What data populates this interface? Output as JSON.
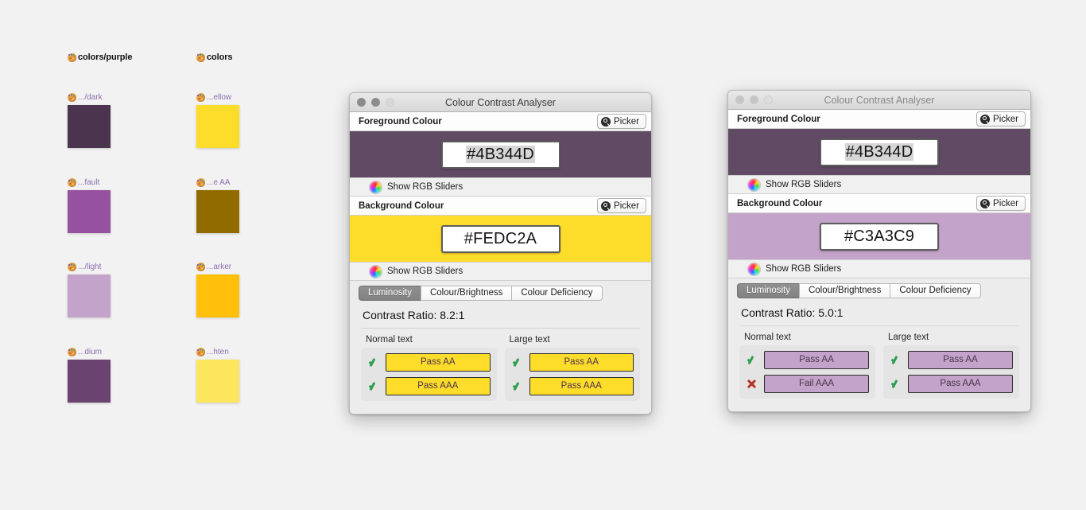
{
  "canvas": {
    "background": "#f2f2f2"
  },
  "palette_panel": {
    "groups": [
      {
        "title": "colors/purple",
        "icon": "palette-icon"
      },
      {
        "title": "colors",
        "icon": "palette-icon"
      }
    ],
    "swatches": [
      {
        "label": ".../dark",
        "color": "#4B344D",
        "icon": "palette-icon",
        "col": 0,
        "row": 0
      },
      {
        "label": "...fault",
        "color": "#96519F",
        "icon": "palette-icon",
        "col": 0,
        "row": 1
      },
      {
        "label": ".../light",
        "color": "#C3A3C9",
        "icon": "palette-icon",
        "col": 0,
        "row": 2
      },
      {
        "label": "...dium",
        "color": "#6B4370",
        "icon": "palette-icon",
        "col": 0,
        "row": 3
      },
      {
        "label": "...ellow",
        "color": "#FEDC2A",
        "icon": "palette-icon",
        "col": 1,
        "row": 0
      },
      {
        "label": "...e AA",
        "color": "#8F6B00",
        "icon": "palette-icon",
        "col": 1,
        "row": 1
      },
      {
        "label": "...arker",
        "color": "#FFBF0A",
        "icon": "palette-icon",
        "col": 1,
        "row": 2
      },
      {
        "label": "...hten",
        "color": "#FCE65E",
        "icon": "palette-icon",
        "col": 1,
        "row": 3
      }
    ]
  },
  "window_1": {
    "title": "Colour Contrast Analyser",
    "active": true,
    "traffic_lights": [
      "close",
      "minimize",
      "zoom"
    ],
    "foreground": {
      "label": "Foreground Colour",
      "picker_label": "Picker",
      "picker_icon": "eyedropper-picker-icon",
      "hex": "#4B344D",
      "selected": true,
      "swatch_color": "#614A64",
      "rgb_toggle_label": "Show RGB Sliders",
      "rgb_toggle_icon": "colour-wheel-icon"
    },
    "background": {
      "label": "Background Colour",
      "picker_label": "Picker",
      "picker_icon": "eyedropper-picker-icon",
      "hex": "#FEDC2A",
      "selected": false,
      "swatch_color": "#FEDC2A",
      "rgb_toggle_label": "Show RGB Sliders",
      "rgb_toggle_icon": "colour-wheel-icon"
    },
    "tabs": [
      {
        "label": "Luminosity",
        "active": true
      },
      {
        "label": "Colour/Brightness",
        "active": false
      },
      {
        "label": "Colour Deficiency",
        "active": false
      }
    ],
    "contrast_ratio": "Contrast Ratio: 8.2:1",
    "results": {
      "normal": {
        "caption": "Normal text",
        "rows": [
          {
            "mark": "pass",
            "text": "Pass AA",
            "bg": "#FEDC2A",
            "fg": "#4B344D"
          },
          {
            "mark": "pass",
            "text": "Pass AAA",
            "bg": "#FEDC2A",
            "fg": "#4B344D"
          }
        ]
      },
      "large": {
        "caption": "Large text",
        "rows": [
          {
            "mark": "pass",
            "text": "Pass AA",
            "bg": "#FEDC2A",
            "fg": "#4B344D"
          },
          {
            "mark": "pass",
            "text": "Pass AAA",
            "bg": "#FEDC2A",
            "fg": "#4B344D"
          }
        ]
      }
    }
  },
  "window_2": {
    "title": "Colour Contrast Analyser",
    "active": false,
    "traffic_lights": [
      "close",
      "minimize",
      "zoom"
    ],
    "foreground": {
      "label": "Foreground Colour",
      "picker_label": "Picker",
      "picker_icon": "eyedropper-picker-icon",
      "hex": "#4B344D",
      "selected": true,
      "swatch_color": "#614A64",
      "rgb_toggle_label": "Show RGB Sliders",
      "rgb_toggle_icon": "colour-wheel-icon"
    },
    "background": {
      "label": "Background Colour",
      "picker_label": "Picker",
      "picker_icon": "eyedropper-picker-icon",
      "hex": "#C3A3C9",
      "selected": false,
      "swatch_color": "#C3A3C9",
      "rgb_toggle_label": "Show RGB Sliders",
      "rgb_toggle_icon": "colour-wheel-icon"
    },
    "tabs": [
      {
        "label": "Luminosity",
        "active": true
      },
      {
        "label": "Colour/Brightness",
        "active": false
      },
      {
        "label": "Colour Deficiency",
        "active": false
      }
    ],
    "contrast_ratio": "Contrast Ratio: 5.0:1",
    "results": {
      "normal": {
        "caption": "Normal text",
        "rows": [
          {
            "mark": "pass",
            "text": "Pass AA",
            "bg": "#C3A3C9",
            "fg": "#4B344D"
          },
          {
            "mark": "fail",
            "text": "Fail AAA",
            "bg": "#C3A3C9",
            "fg": "#4B344D"
          }
        ]
      },
      "large": {
        "caption": "Large text",
        "rows": [
          {
            "mark": "pass",
            "text": "Pass AA",
            "bg": "#C3A3C9",
            "fg": "#4B344D"
          },
          {
            "mark": "pass",
            "text": "Pass AAA",
            "bg": "#C3A3C9",
            "fg": "#4B344D"
          }
        ]
      }
    }
  }
}
